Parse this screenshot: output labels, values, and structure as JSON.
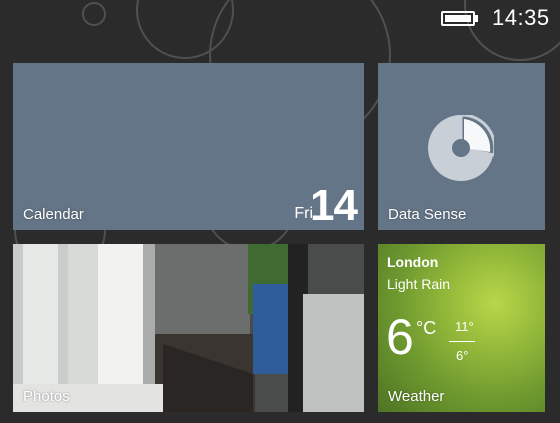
{
  "status_bar": {
    "time": "14:35",
    "battery_icon": "battery-full-icon"
  },
  "tiles": {
    "calendar": {
      "label": "Calendar",
      "day": "Fri",
      "date": "14"
    },
    "data_sense": {
      "label": "Data Sense",
      "icon": "pie-chart-icon",
      "usage_fraction": 0.32
    },
    "photos": {
      "label": "Photos"
    },
    "weather": {
      "label": "Weather",
      "city": "London",
      "condition": "Light Rain",
      "temperature": "6",
      "unit": "°C",
      "high": "11°",
      "low": "6°"
    }
  },
  "colors": {
    "background": "#2b2b2b",
    "tile_accent": "#647587",
    "weather_green": "#94b93a"
  }
}
